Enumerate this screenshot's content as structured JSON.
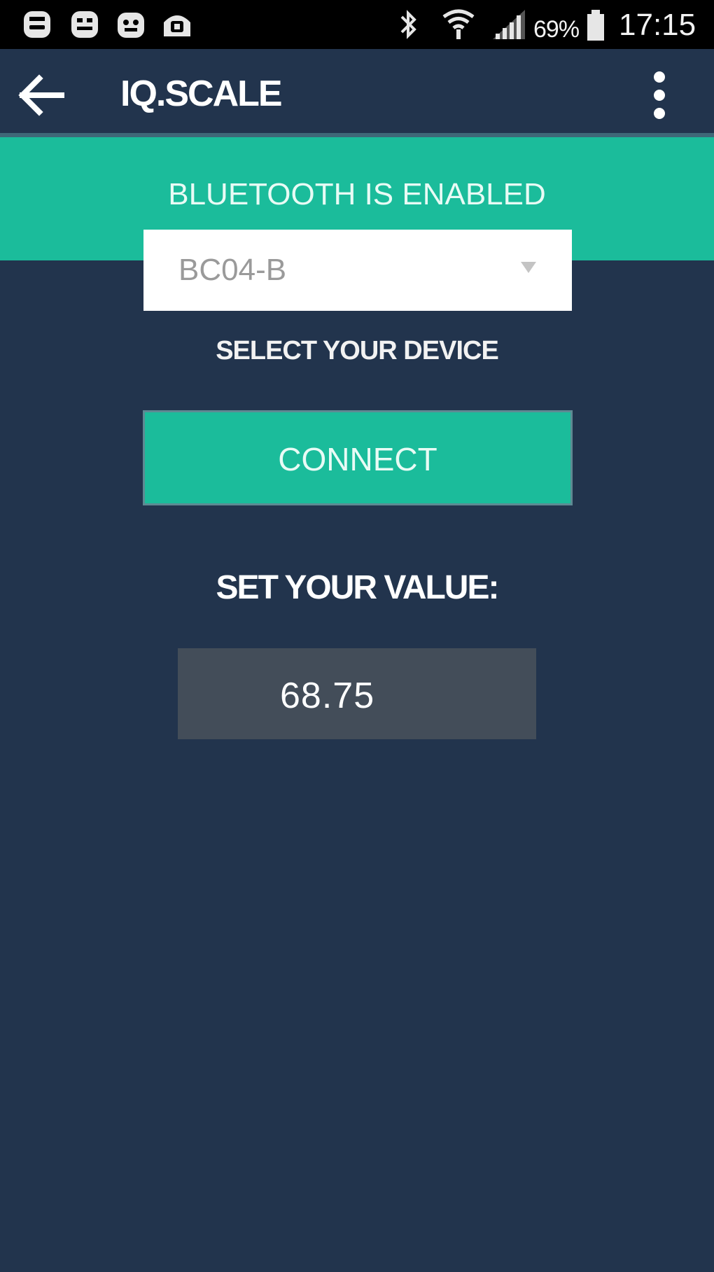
{
  "status_bar": {
    "battery_percent": "69%",
    "time": "17:15",
    "icons": [
      "notification-app-icon",
      "notification-app-icon",
      "notification-app-icon",
      "notification-app-icon",
      "bluetooth-icon",
      "wifi-icon",
      "signal-icon",
      "battery-icon"
    ]
  },
  "app_bar": {
    "title": "IQ.SCALE",
    "back_icon": "arrow-left-icon",
    "menu_icon": "more-vertical-icon"
  },
  "bluetooth_banner": {
    "text": "BLUETOOTH IS ENABLED"
  },
  "device_select": {
    "selected": "BC04-B",
    "label": "SELECT YOUR DEVICE"
  },
  "connect_button": {
    "label": "CONNECT"
  },
  "value_section": {
    "label": "SET YOUR VALUE:",
    "value": "68.75"
  },
  "colors": {
    "background": "#22344d",
    "accent": "#1bbc9b",
    "status_bar": "#000000",
    "value_field": "#434d59"
  }
}
